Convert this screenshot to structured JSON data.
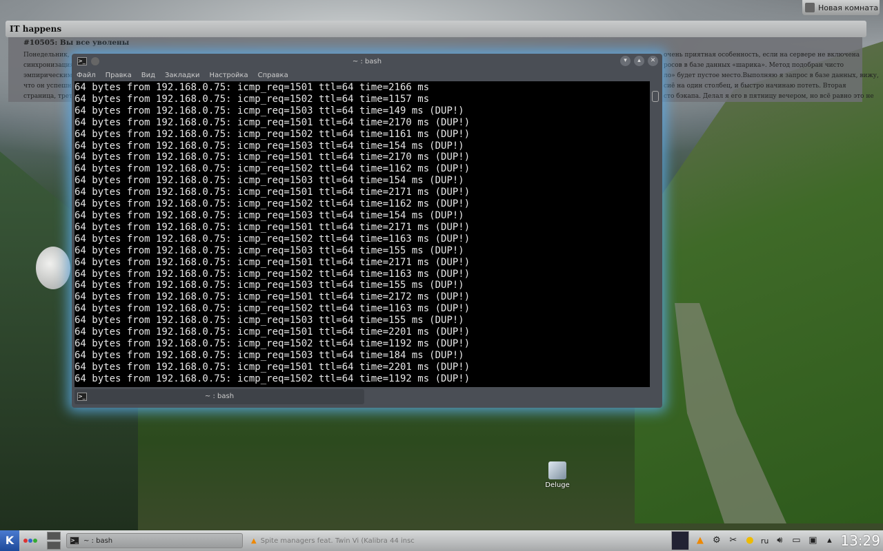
{
  "desktop": {
    "new_room_label": "Новая комната",
    "icon_label": "Deluge"
  },
  "ithappens": {
    "title": "IT happens",
    "story_title": "#10505: Вы все уволены",
    "left_lines": [
      "Понедельник,",
      "синхронизация",
      "эмпирическим",
      "что он успешно",
      "страница, третья"
    ],
    "right_lines": [
      "очень приятная особенность, если на сервере не включена",
      "росов в базе данных «шарика». Метод подобран чисто",
      "ло» будет пустое место.Выполняю я запрос в базе данных, вижу,",
      "сиё на один столбец, и быстро начинаю потеть. Вторая",
      "сто бэкапа. Делал я его в пятницу вечером, но всё равно это не"
    ]
  },
  "terminal": {
    "title": "~ : bash",
    "tab_label": "~ : bash",
    "menu": [
      "Файл",
      "Правка",
      "Вид",
      "Закладки",
      "Настройка",
      "Справка"
    ],
    "lines": [
      "64 bytes from 192.168.0.75: icmp_req=1501 ttl=64 time=2166 ms",
      "64 bytes from 192.168.0.75: icmp_req=1502 ttl=64 time=1157 ms",
      "64 bytes from 192.168.0.75: icmp_req=1503 ttl=64 time=149 ms (DUP!)",
      "64 bytes from 192.168.0.75: icmp_req=1501 ttl=64 time=2170 ms (DUP!)",
      "64 bytes from 192.168.0.75: icmp_req=1502 ttl=64 time=1161 ms (DUP!)",
      "64 bytes from 192.168.0.75: icmp_req=1503 ttl=64 time=154 ms (DUP!)",
      "64 bytes from 192.168.0.75: icmp_req=1501 ttl=64 time=2170 ms (DUP!)",
      "64 bytes from 192.168.0.75: icmp_req=1502 ttl=64 time=1162 ms (DUP!)",
      "64 bytes from 192.168.0.75: icmp_req=1503 ttl=64 time=154 ms (DUP!)",
      "64 bytes from 192.168.0.75: icmp_req=1501 ttl=64 time=2171 ms (DUP!)",
      "64 bytes from 192.168.0.75: icmp_req=1502 ttl=64 time=1162 ms (DUP!)",
      "64 bytes from 192.168.0.75: icmp_req=1503 ttl=64 time=154 ms (DUP!)",
      "64 bytes from 192.168.0.75: icmp_req=1501 ttl=64 time=2171 ms (DUP!)",
      "64 bytes from 192.168.0.75: icmp_req=1502 ttl=64 time=1163 ms (DUP!)",
      "64 bytes from 192.168.0.75: icmp_req=1503 ttl=64 time=155 ms (DUP!)",
      "64 bytes from 192.168.0.75: icmp_req=1501 ttl=64 time=2171 ms (DUP!)",
      "64 bytes from 192.168.0.75: icmp_req=1502 ttl=64 time=1163 ms (DUP!)",
      "64 bytes from 192.168.0.75: icmp_req=1503 ttl=64 time=155 ms (DUP!)",
      "64 bytes from 192.168.0.75: icmp_req=1501 ttl=64 time=2172 ms (DUP!)",
      "64 bytes from 192.168.0.75: icmp_req=1502 ttl=64 time=1163 ms (DUP!)",
      "64 bytes from 192.168.0.75: icmp_req=1503 ttl=64 time=155 ms (DUP!)",
      "64 bytes from 192.168.0.75: icmp_req=1501 ttl=64 time=2201 ms (DUP!)",
      "64 bytes from 192.168.0.75: icmp_req=1502 ttl=64 time=1192 ms (DUP!)",
      "64 bytes from 192.168.0.75: icmp_req=1503 ttl=64 time=184 ms (DUP!)",
      "64 bytes from 192.168.0.75: icmp_req=1501 ttl=64 time=2201 ms (DUP!)",
      "64 bytes from 192.168.0.75: icmp_req=1502 ttl=64 time=1192 ms (DUP!)"
    ]
  },
  "taskbar": {
    "tasks": [
      "~ : bash",
      "Spite managers feat. Twin Vi (Kalibra 44 insc"
    ],
    "keyboard_layout": "ru",
    "clock": "13:29"
  }
}
